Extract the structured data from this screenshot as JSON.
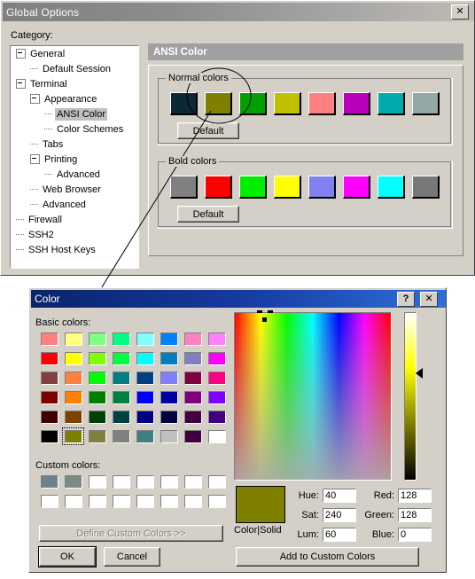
{
  "global_options": {
    "title": "Global Options",
    "close_label": "✕",
    "category_label": "Category:",
    "tree": [
      {
        "label": "General",
        "indent": 0,
        "type": "expander",
        "selected": false
      },
      {
        "label": "Default Session",
        "indent": 1,
        "type": "leaf",
        "selected": false
      },
      {
        "label": "Terminal",
        "indent": 0,
        "type": "expander",
        "selected": false
      },
      {
        "label": "Appearance",
        "indent": 1,
        "type": "expander",
        "selected": false
      },
      {
        "label": "ANSI Color",
        "indent": 2,
        "type": "leaf",
        "selected": true
      },
      {
        "label": "Color Schemes",
        "indent": 2,
        "type": "leaf",
        "selected": false
      },
      {
        "label": "Tabs",
        "indent": 1,
        "type": "leaf",
        "selected": false
      },
      {
        "label": "Printing",
        "indent": 1,
        "type": "expander",
        "selected": false
      },
      {
        "label": "Advanced",
        "indent": 2,
        "type": "leaf",
        "selected": false
      },
      {
        "label": "Web Browser",
        "indent": 1,
        "type": "leaf",
        "selected": false
      },
      {
        "label": "Advanced",
        "indent": 1,
        "type": "leaf",
        "selected": false
      },
      {
        "label": "Firewall",
        "indent": 0,
        "type": "leaf",
        "selected": false
      },
      {
        "label": "SSH2",
        "indent": 0,
        "type": "leaf",
        "selected": false
      },
      {
        "label": "SSH Host Keys",
        "indent": 0,
        "type": "leaf",
        "selected": false
      }
    ],
    "pane": {
      "header": "ANSI Color",
      "normal_group": {
        "title": "Normal colors",
        "swatches": [
          "#0b2836",
          "#808000",
          "#00a000",
          "#c0c000",
          "#ff8080",
          "#b800b8",
          "#00acac",
          "#94a8a8"
        ],
        "default_button": "Default"
      },
      "bold_group": {
        "title": "Bold colors",
        "swatches": [
          "#808080",
          "#ff0000",
          "#00ee00",
          "#ffff00",
          "#8080f0",
          "#ff00ff",
          "#00ffff",
          "#787878"
        ],
        "default_button": "Default"
      }
    },
    "annotation": {
      "highlight_target": "normal-color-swatch-2",
      "leader_line_to": "color-dialog-titlebar"
    }
  },
  "color_dialog": {
    "title": "Color",
    "help_label": "?",
    "close_label": "✕",
    "basic_colors_label": "Basic colors:",
    "basic_colors": [
      [
        "#ff8080",
        "#ffff80",
        "#80ff80",
        "#00ff80",
        "#80ffff",
        "#0080ff",
        "#ff80c0",
        "#ff80ff"
      ],
      [
        "#ff0000",
        "#ffff00",
        "#80ff00",
        "#00ff40",
        "#00ffff",
        "#0080c0",
        "#8080c0",
        "#ff00ff"
      ],
      [
        "#804040",
        "#ff8040",
        "#00ff00",
        "#008080",
        "#004080",
        "#8080ff",
        "#800040",
        "#ff0080"
      ],
      [
        "#800000",
        "#ff8000",
        "#008000",
        "#008040",
        "#0000ff",
        "#0000a0",
        "#800080",
        "#8000ff"
      ],
      [
        "#400000",
        "#804000",
        "#004000",
        "#004040",
        "#000080",
        "#000040",
        "#400040",
        "#400080"
      ],
      [
        "#000000",
        "#808000",
        "#808040",
        "#808080",
        "#408080",
        "#c0c0c0",
        "#400040",
        "#ffffff"
      ]
    ],
    "basic_selected": {
      "row": 5,
      "col": 1
    },
    "custom_colors_label": "Custom colors:",
    "custom_colors": [
      [
        "#6f8289",
        "#788c84",
        "#ffffff",
        "#ffffff",
        "#ffffff",
        "#ffffff",
        "#ffffff",
        "#ffffff"
      ],
      [
        "#ffffff",
        "#ffffff",
        "#ffffff",
        "#ffffff",
        "#ffffff",
        "#ffffff",
        "#ffffff",
        "#ffffff"
      ]
    ],
    "define_custom_button": "Define Custom Colors >>",
    "ok_button": "OK",
    "cancel_button": "Cancel",
    "add_to_custom_button": "Add to Custom Colors",
    "preview_label": "Color|Solid",
    "preview_color": "#808000",
    "fields": {
      "hue": {
        "label": "Hue:",
        "value": "40"
      },
      "sat": {
        "label": "Sat:",
        "value": "240"
      },
      "lum": {
        "label": "Lum:",
        "value": "60"
      },
      "red": {
        "label": "Red:",
        "value": "128"
      },
      "green": {
        "label": "Green:",
        "value": "128"
      },
      "blue": {
        "label": "Blue:",
        "value": "0"
      }
    }
  }
}
